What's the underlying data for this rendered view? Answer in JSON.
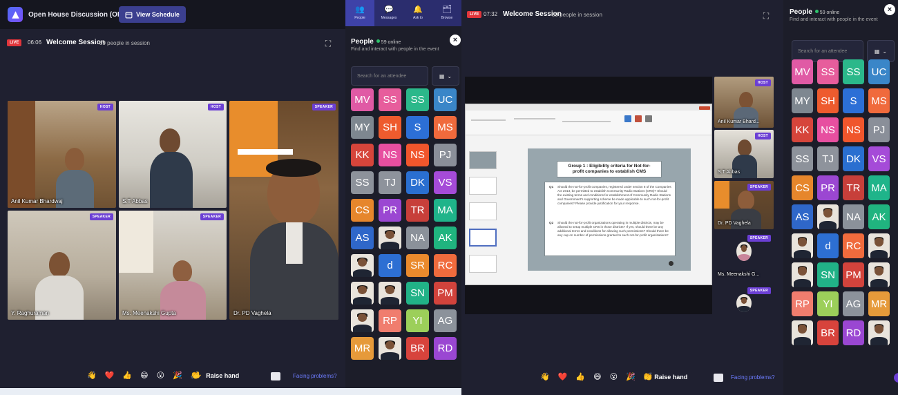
{
  "colors": {
    "bg": "#1f2030",
    "panel": "#1c1d29",
    "live": "#e0353b",
    "role_badge": "#6b3fd4",
    "accent": "#3b3f8f",
    "link": "#6d7cff"
  },
  "left": {
    "app_title": "Open House Discussion (OHD)",
    "schedule_button": "View Schedule",
    "live_label": "LIVE",
    "timer": "06:06",
    "session_title": "Welcome Session",
    "session_count": "59 people in session",
    "videos": [
      {
        "name": "Anil Kumar Bhardwaj",
        "role": "HOST"
      },
      {
        "name": "S.T Abbas",
        "role": "HOST"
      },
      {
        "name": "",
        "role": "SPEAKER"
      },
      {
        "name": "Y. Raghuraman",
        "role": "SPEAKER"
      },
      {
        "name": "Ms. Meenakshi Gupta",
        "role": "SPEAKER"
      },
      {
        "name": "Dr. PD Vaghela",
        "role": ""
      }
    ],
    "reactions": [
      "👋",
      "❤️",
      "👍",
      "😄",
      "😮",
      "🎉",
      "👏"
    ],
    "raise_hand": "Raise hand",
    "facing_problems": "Facing problems?",
    "tabs": [
      {
        "label": "People",
        "icon": "people-icon"
      },
      {
        "label": "Messages",
        "icon": "chat-icon"
      },
      {
        "label": "Ask to",
        "icon": "bell-icon"
      },
      {
        "label": "Browse",
        "icon": "browse-icon"
      }
    ],
    "people_title": "People",
    "people_online": "59 online",
    "people_sub": "Find and interact with people in the event",
    "search_placeholder": "Search for an attendee",
    "avatars": [
      {
        "t": "MV",
        "c": "#e05aa5"
      },
      {
        "t": "SS",
        "c": "#e75d9c"
      },
      {
        "t": "SS",
        "c": "#2bb88a"
      },
      {
        "t": "UC",
        "c": "#3a86c8"
      },
      {
        "t": "MY",
        "c": "#7e8790"
      },
      {
        "t": "SH",
        "c": "#ee5b2e"
      },
      {
        "t": "S",
        "c": "#2c6fd6"
      },
      {
        "t": "MS",
        "c": "#f06a3c"
      },
      {
        "t": "KK",
        "c": "#d6453b"
      },
      {
        "t": "NS",
        "c": "#e74fa0"
      },
      {
        "t": "NS",
        "c": "#f0562c"
      },
      {
        "t": "PJ",
        "c": "#8a8f99"
      },
      {
        "t": "SS",
        "c": "#8d929b"
      },
      {
        "t": "TJ",
        "c": "#8e939c"
      },
      {
        "t": "DK",
        "c": "#2a6fd0"
      },
      {
        "t": "VS",
        "c": "#a54bd8"
      },
      {
        "t": "CS",
        "c": "#e6862c"
      },
      {
        "t": "PR",
        "c": "#9b47d2"
      },
      {
        "t": "TR",
        "c": "#c73f3a"
      },
      {
        "t": "MA",
        "c": "#1fb48a"
      },
      {
        "t": "AS",
        "c": "#2f67c9"
      },
      {
        "t": "",
        "c": "photo"
      },
      {
        "t": "NA",
        "c": "#8b919a"
      },
      {
        "t": "AK",
        "c": "#20b47f"
      },
      {
        "t": "",
        "c": "photo"
      },
      {
        "t": "d",
        "c": "#2d6fd3"
      },
      {
        "t": "SR",
        "c": "#ea8a2d"
      },
      {
        "t": "RC",
        "c": "#f06b3d"
      },
      {
        "t": "",
        "c": "photo"
      },
      {
        "t": "",
        "c": "photo"
      },
      {
        "t": "SN",
        "c": "#21b287"
      },
      {
        "t": "PM",
        "c": "#d2433c"
      },
      {
        "t": "",
        "c": "photo"
      },
      {
        "t": "RP",
        "c": "#f07d6e"
      },
      {
        "t": "YI",
        "c": "#9ccf5a"
      },
      {
        "t": "AG",
        "c": "#8c929b"
      },
      {
        "t": "MR",
        "c": "#e69a3a"
      },
      {
        "t": "",
        "c": "photo"
      },
      {
        "t": "BR",
        "c": "#d7433c"
      },
      {
        "t": "RD",
        "c": "#9a47d2"
      }
    ]
  },
  "right": {
    "live_label": "LIVE",
    "timer": "07:32",
    "session_title": "Welcome Session",
    "session_count": "59 people in session",
    "people_title": "People",
    "people_online": "59 online",
    "people_sub": "Find and interact with people in the event",
    "search_placeholder": "Search for an attendee",
    "slide_title": "Group 1 : Eligibility criteria for Not-for-profit companies to establish CMS",
    "slide_q1": "Should the not-for-profit companies, registered under section 8 of the Companies Act 2013, be permitted to establish Community Radio Stations (CRS)? Should the existing terms and conditions for establishment of Community Radio Stations and Government's supporting scheme be made applicable to such not-for-profit companies? Please provide justification for your response.",
    "slide_q2": "Should the not-for-profit organizations operating in multiple districts, may be allowed to setup multiple CRS in those districts? If yes, should there be any additional terms and conditions for allowing such permissions? Should there be any cap on number of permissions granted to such not-for-profit organizations?",
    "videos": [
      {
        "name": "Anil Kumar Bhard...",
        "role": "HOST"
      },
      {
        "name": "S.T Abbas",
        "role": "HOST"
      },
      {
        "name": "Dr. PD Vaghela",
        "role": "SPEAKER"
      },
      {
        "name": "Ms. Meenakshi G...",
        "role": "SPEAKER"
      },
      {
        "name": "",
        "role": "SPEAKER"
      }
    ],
    "reactions": [
      "👋",
      "❤️",
      "👍",
      "😄",
      "😮",
      "🎉",
      "👏"
    ],
    "raise_hand": "Raise hand",
    "facing_problems": "Facing problems?",
    "avatars": [
      {
        "t": "MV",
        "c": "#e05aa5"
      },
      {
        "t": "SS",
        "c": "#e75d9c"
      },
      {
        "t": "SS",
        "c": "#2bb88a"
      },
      {
        "t": "UC",
        "c": "#3a86c8"
      },
      {
        "t": "MY",
        "c": "#7e8790"
      },
      {
        "t": "SH",
        "c": "#ee5b2e"
      },
      {
        "t": "S",
        "c": "#2c6fd6"
      },
      {
        "t": "MS",
        "c": "#f06a3c"
      },
      {
        "t": "KK",
        "c": "#d6453b"
      },
      {
        "t": "NS",
        "c": "#e74fa0"
      },
      {
        "t": "NS",
        "c": "#f0562c"
      },
      {
        "t": "PJ",
        "c": "#8a8f99"
      },
      {
        "t": "SS",
        "c": "#8d929b"
      },
      {
        "t": "TJ",
        "c": "#8e939c"
      },
      {
        "t": "DK",
        "c": "#2a6fd0"
      },
      {
        "t": "VS",
        "c": "#a54bd8"
      },
      {
        "t": "CS",
        "c": "#e6862c"
      },
      {
        "t": "PR",
        "c": "#9b47d2"
      },
      {
        "t": "TR",
        "c": "#c73f3a"
      },
      {
        "t": "MA",
        "c": "#1fb48a"
      },
      {
        "t": "AS",
        "c": "#2f67c9"
      },
      {
        "t": "",
        "c": "photo"
      },
      {
        "t": "NA",
        "c": "#8b919a"
      },
      {
        "t": "AK",
        "c": "#20b47f"
      },
      {
        "t": "",
        "c": "photo"
      },
      {
        "t": "d",
        "c": "#2d6fd3"
      },
      {
        "t": "RC",
        "c": "#f06b3d"
      },
      {
        "t": "",
        "c": "photo"
      },
      {
        "t": "",
        "c": "photo"
      },
      {
        "t": "SN",
        "c": "#21b287"
      },
      {
        "t": "PM",
        "c": "#d2433c"
      },
      {
        "t": "",
        "c": "photo"
      },
      {
        "t": "RP",
        "c": "#f07d6e"
      },
      {
        "t": "YI",
        "c": "#9ccf5a"
      },
      {
        "t": "AG",
        "c": "#8c929b"
      },
      {
        "t": "MR",
        "c": "#e69a3a"
      },
      {
        "t": "",
        "c": "photo"
      },
      {
        "t": "BR",
        "c": "#d7433c"
      },
      {
        "t": "RD",
        "c": "#9a47d2"
      },
      {
        "t": "",
        "c": "photo"
      }
    ]
  }
}
